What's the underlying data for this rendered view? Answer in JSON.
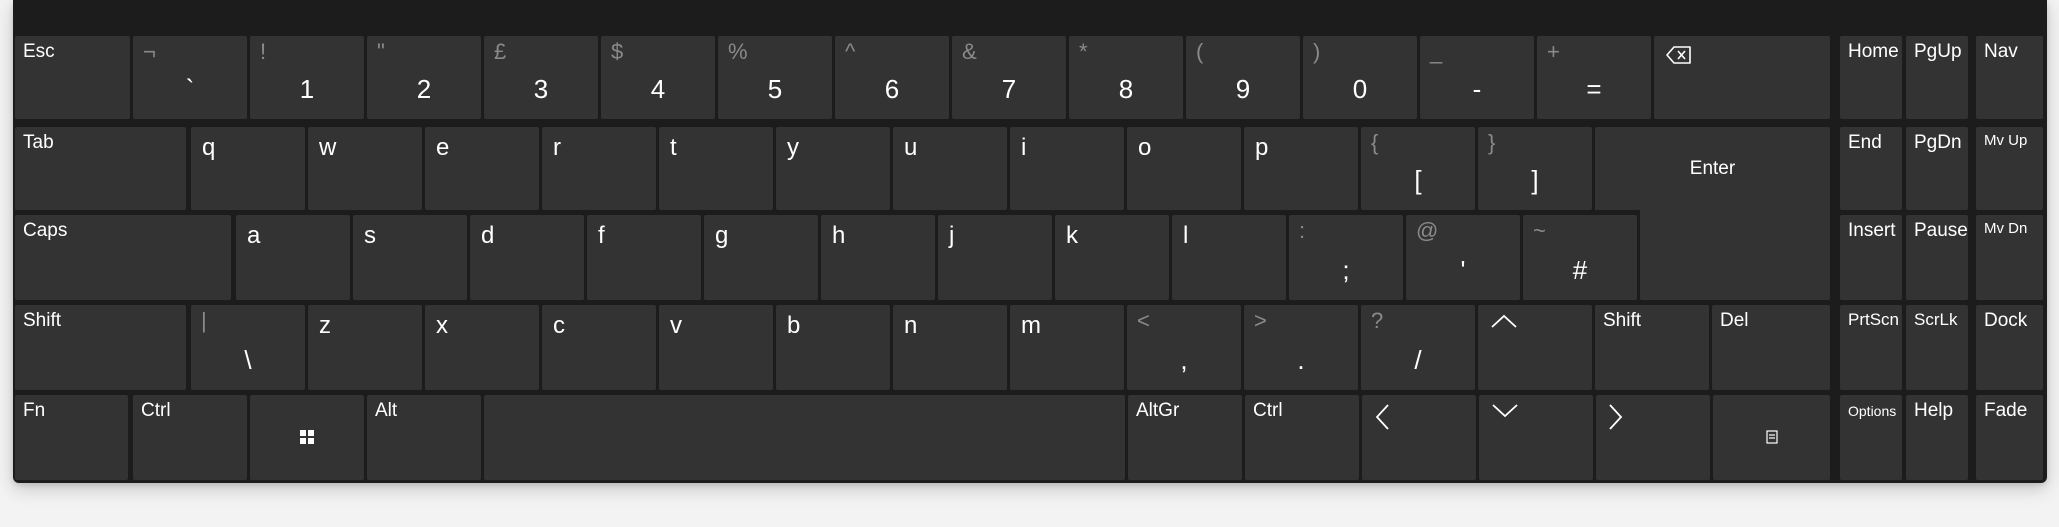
{
  "keyboard": {
    "row1": {
      "esc": "Esc",
      "backtick": {
        "upper": "¬",
        "lower": "`"
      },
      "k1": {
        "upper": "!",
        "lower": "1"
      },
      "k2": {
        "upper": "\"",
        "lower": "2"
      },
      "k3": {
        "upper": "£",
        "lower": "3"
      },
      "k4": {
        "upper": "$",
        "lower": "4"
      },
      "k5": {
        "upper": "%",
        "lower": "5"
      },
      "k6": {
        "upper": "^",
        "lower": "6"
      },
      "k7": {
        "upper": "&",
        "lower": "7"
      },
      "k8": {
        "upper": "*",
        "lower": "8"
      },
      "k9": {
        "upper": "(",
        "lower": "9"
      },
      "k0": {
        "upper": ")",
        "lower": "0"
      },
      "minus": {
        "upper": "_",
        "lower": "-"
      },
      "equals": {
        "upper": "+",
        "lower": "="
      },
      "backspace_icon": "backspace-icon"
    },
    "row2": {
      "tab": "Tab",
      "letters": [
        "q",
        "w",
        "e",
        "r",
        "t",
        "y",
        "u",
        "i",
        "o",
        "p"
      ],
      "lbracket": {
        "upper": "{",
        "lower": "["
      },
      "rbracket": {
        "upper": "}",
        "lower": "]"
      },
      "enter": "Enter"
    },
    "row3": {
      "caps": "Caps",
      "letters": [
        "a",
        "s",
        "d",
        "f",
        "g",
        "h",
        "j",
        "k",
        "l"
      ],
      "semicolon": {
        "upper": ":",
        "lower": ";"
      },
      "quote": {
        "upper": "@",
        "lower": "'"
      },
      "hash": {
        "upper": "~",
        "lower": "#"
      }
    },
    "row4": {
      "shift_left": "Shift",
      "backslash": {
        "upper": "|",
        "lower": "\\"
      },
      "letters": [
        "z",
        "x",
        "c",
        "v",
        "b",
        "n",
        "m"
      ],
      "comma": {
        "upper": "<",
        "lower": ","
      },
      "period": {
        "upper": ">",
        "lower": "."
      },
      "slash": {
        "upper": "?",
        "lower": "/"
      },
      "shift_right": "Shift",
      "del": "Del"
    },
    "row5": {
      "fn": "Fn",
      "ctrl_left": "Ctrl",
      "alt": "Alt",
      "altgr": "AltGr",
      "ctrl_right": "Ctrl"
    },
    "nav": {
      "home": "Home",
      "pgup": "PgUp",
      "nav": "Nav",
      "end": "End",
      "pgdn": "PgDn",
      "mvup": "Mv Up",
      "insert": "Insert",
      "pause": "Pause",
      "mvdn": "Mv Dn",
      "prtscn": "PrtScn",
      "scrlk": "ScrLk",
      "dock": "Dock",
      "options": "Options",
      "help": "Help",
      "fade": "Fade"
    }
  },
  "colors": {
    "background": "#1c1c1c",
    "key": "#333333",
    "text": "#ffffff",
    "secondary_text": "#8a8a8a"
  }
}
